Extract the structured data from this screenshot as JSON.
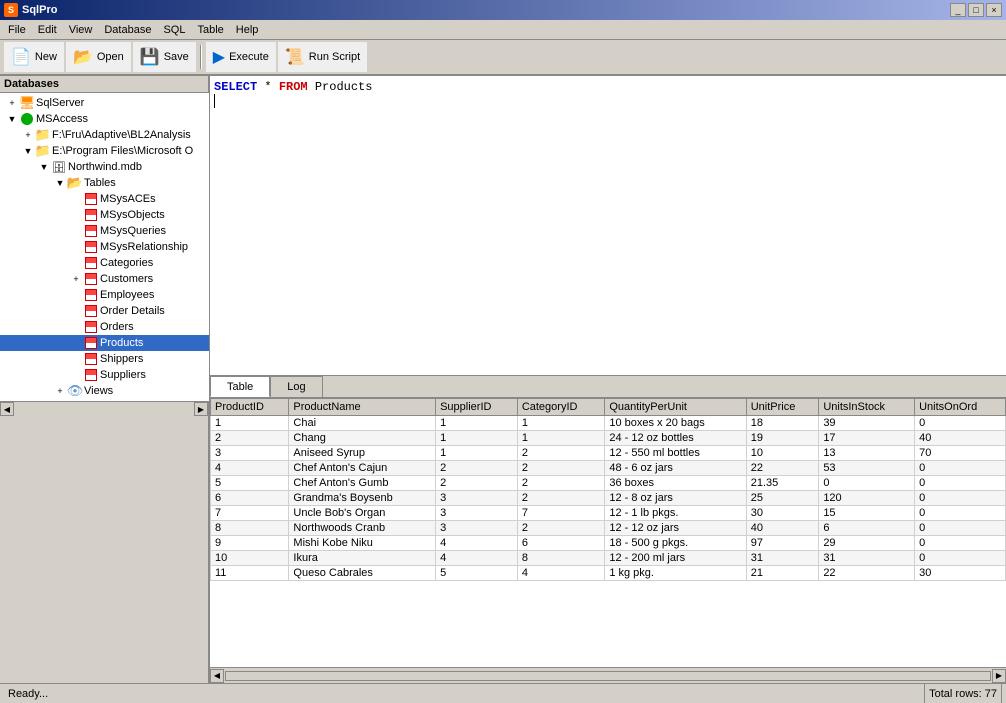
{
  "titleBar": {
    "icon": "S",
    "title": "SqlPro",
    "controls": [
      "_",
      "□",
      "×"
    ]
  },
  "menuBar": {
    "items": [
      "File",
      "Edit",
      "View",
      "Database",
      "SQL",
      "Table",
      "Help"
    ]
  },
  "toolbar": {
    "buttons": [
      {
        "label": "New",
        "icon": "📄"
      },
      {
        "label": "Open",
        "icon": "📂"
      },
      {
        "label": "Save",
        "icon": "💾"
      },
      {
        "label": "Execute",
        "icon": "▶"
      },
      {
        "label": "Run Script",
        "icon": "📜"
      }
    ]
  },
  "sidebar": {
    "header": "Databases",
    "tree": [
      {
        "level": 1,
        "type": "server",
        "label": "SqlServer",
        "expanded": false
      },
      {
        "level": 1,
        "type": "db",
        "label": "MSAccess",
        "expanded": true
      },
      {
        "level": 2,
        "type": "folder",
        "label": "F:\\Fru\\Adaptive\\BL2Analysis",
        "expanded": false
      },
      {
        "level": 2,
        "type": "folder",
        "label": "E:\\Program Files\\Microsoft O",
        "expanded": true
      },
      {
        "level": 3,
        "type": "mdb",
        "label": "Northwind.mdb",
        "expanded": true
      },
      {
        "level": 4,
        "type": "tables",
        "label": "Tables",
        "expanded": true
      },
      {
        "level": 5,
        "type": "table",
        "label": "MSysACEs"
      },
      {
        "level": 5,
        "type": "table",
        "label": "MSysObjects"
      },
      {
        "level": 5,
        "type": "table",
        "label": "MSysQueries"
      },
      {
        "level": 5,
        "type": "table",
        "label": "MSysRelationship"
      },
      {
        "level": 5,
        "type": "table",
        "label": "Categories"
      },
      {
        "level": 5,
        "type": "table",
        "label": "Customers",
        "hasExpand": true
      },
      {
        "level": 5,
        "type": "table",
        "label": "Employees"
      },
      {
        "level": 5,
        "type": "table",
        "label": "Order Details"
      },
      {
        "level": 5,
        "type": "table",
        "label": "Orders"
      },
      {
        "level": 5,
        "type": "table",
        "label": "Products",
        "selected": true
      },
      {
        "level": 5,
        "type": "table",
        "label": "Shippers"
      },
      {
        "level": 5,
        "type": "table",
        "label": "Suppliers"
      },
      {
        "level": 4,
        "type": "views",
        "label": "Views"
      }
    ]
  },
  "sqlEditor": {
    "content": "SELECT * FROM Products"
  },
  "tabs": [
    {
      "label": "Table",
      "active": true
    },
    {
      "label": "Log",
      "active": false
    }
  ],
  "grid": {
    "columns": [
      "ProductID",
      "ProductName",
      "SupplierID",
      "CategoryID",
      "QuantityPerUnit",
      "UnitPrice",
      "UnitsInStock",
      "UnitsOnOrd"
    ],
    "rows": [
      [
        1,
        "Chai",
        1,
        1,
        "10 boxes x 20 bags",
        18,
        39,
        0
      ],
      [
        2,
        "Chang",
        1,
        1,
        "24 - 12 oz bottles",
        19,
        17,
        40
      ],
      [
        3,
        "Aniseed Syrup",
        1,
        2,
        "12 - 550 ml bottles",
        10,
        13,
        70
      ],
      [
        4,
        "Chef Anton's Cajun",
        2,
        2,
        "48 - 6 oz jars",
        22,
        53,
        0
      ],
      [
        5,
        "Chef Anton's Gumb",
        2,
        2,
        "36 boxes",
        21.35,
        0,
        0
      ],
      [
        6,
        "Grandma's Boysenb",
        3,
        2,
        "12 - 8 oz jars",
        25,
        120,
        0
      ],
      [
        7,
        "Uncle Bob's Organ",
        3,
        7,
        "12 - 1 lb pkgs.",
        30,
        15,
        0
      ],
      [
        8,
        "Northwoods Cranb",
        3,
        2,
        "12 - 12 oz jars",
        40,
        6,
        0
      ],
      [
        9,
        "Mishi Kobe Niku",
        4,
        6,
        "18 - 500 g pkgs.",
        97,
        29,
        0
      ],
      [
        10,
        "Ikura",
        4,
        8,
        "12 - 200 ml jars",
        31,
        31,
        0
      ],
      [
        11,
        "Queso Cabrales",
        5,
        4,
        "1 kg pkg.",
        21,
        22,
        30
      ]
    ]
  },
  "statusBar": {
    "ready": "Ready...",
    "totalRows": "Total rows: 77"
  }
}
